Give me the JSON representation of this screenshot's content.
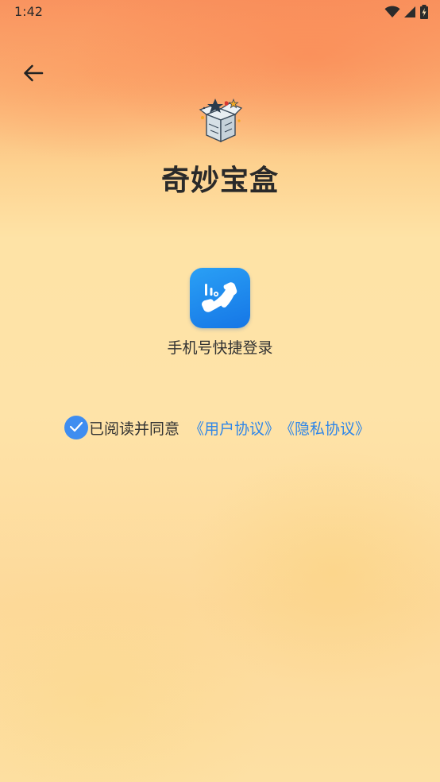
{
  "status_bar": {
    "time": "1:42",
    "icons": [
      "wifi-icon",
      "signal-icon",
      "battery-icon"
    ]
  },
  "header": {
    "back_icon": "arrow-left-icon"
  },
  "brand": {
    "logo_icon": "treasure-box-logo",
    "title": "奇妙宝盒"
  },
  "login": {
    "phone_icon": "phone-quick-login-icon",
    "label": "手机号快捷登录"
  },
  "agreement": {
    "checked": true,
    "prefix": "已阅读并同意",
    "user_agreement": "《用户协议》",
    "privacy_policy": "《隐私协议》"
  },
  "colors": {
    "accent_blue": "#2f86e8",
    "checkbox_blue": "#3f8df0",
    "title_text": "#2a2a2a",
    "bg_top": "#f9935f",
    "bg_bottom": "#fee3a6"
  }
}
